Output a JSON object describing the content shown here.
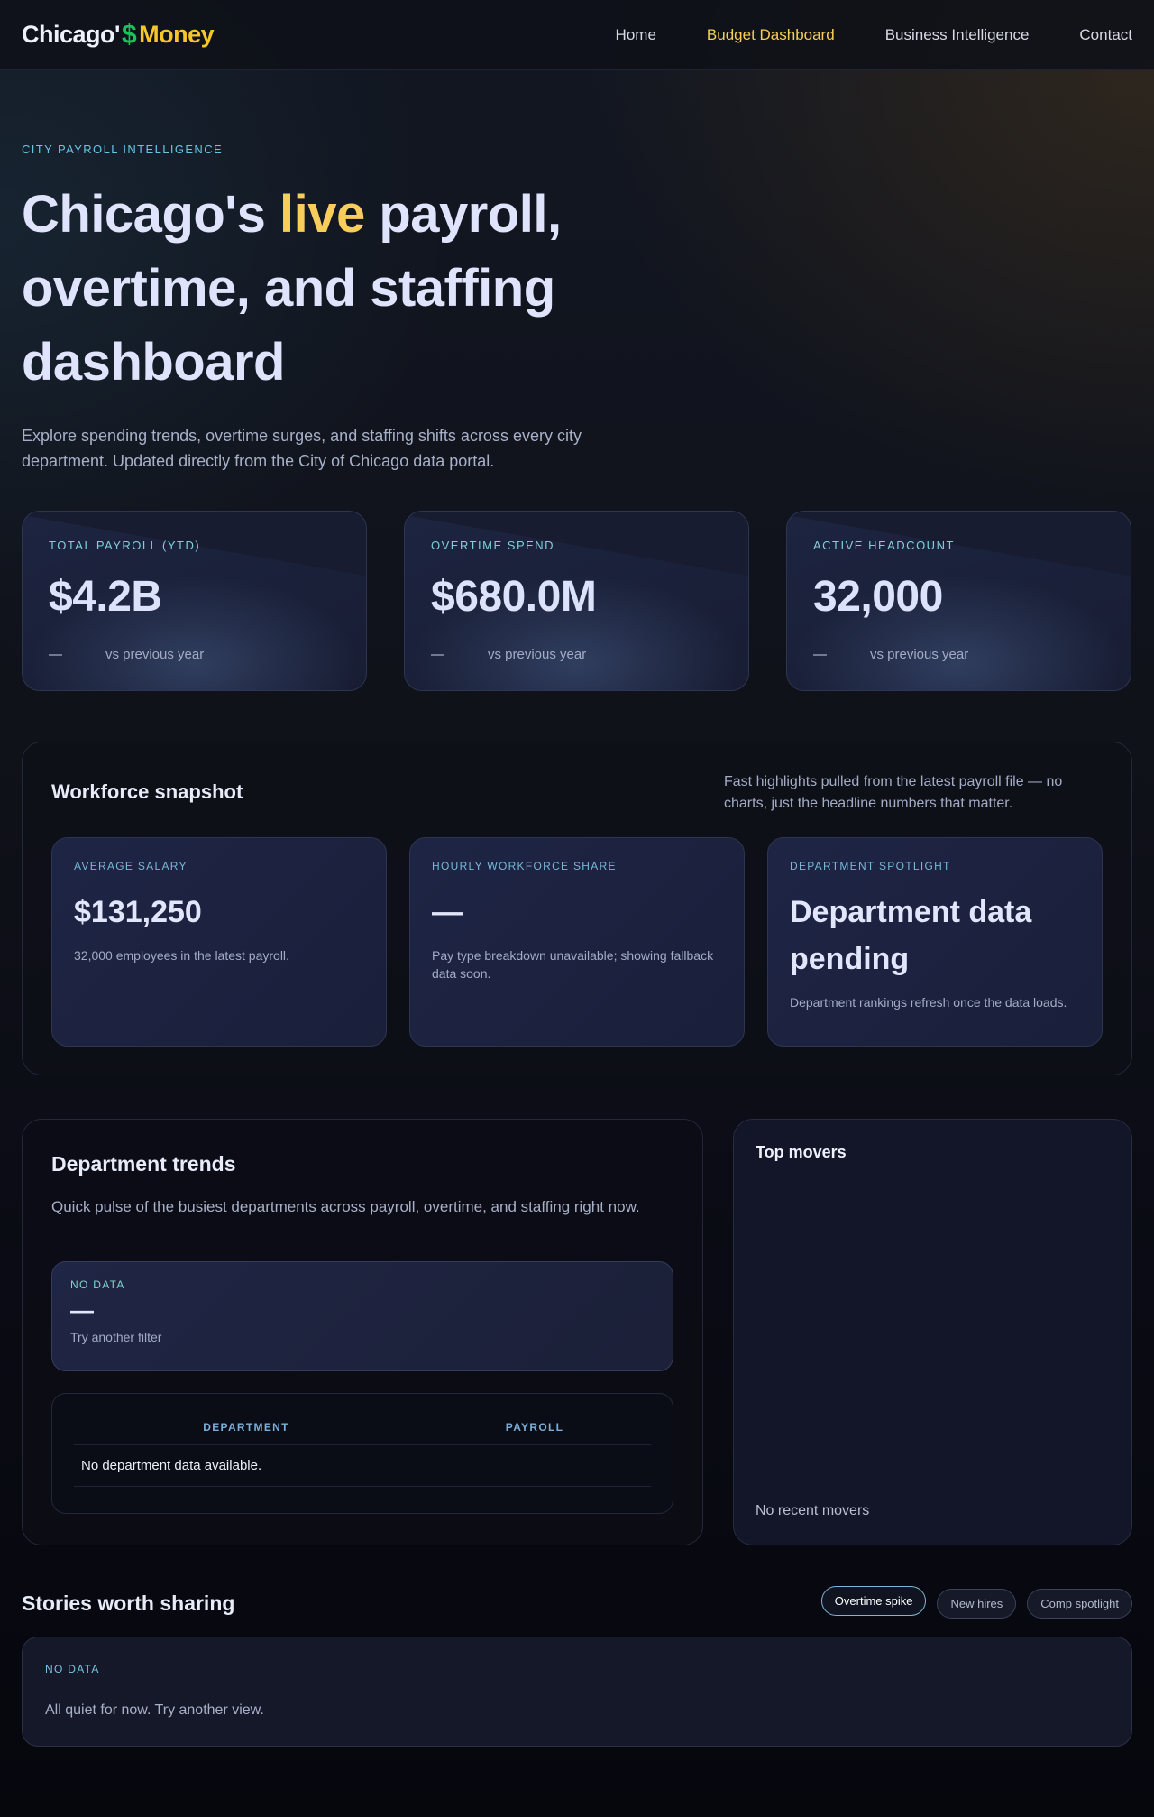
{
  "nav": {
    "logo_part1": "Chicago'",
    "logo_symbol": "$",
    "logo_part2": "Money",
    "links": [
      "Home",
      "Budget Dashboard",
      "Business Intelligence",
      "Contact"
    ],
    "active_link": "Budget Dashboard"
  },
  "hero": {
    "eyebrow": "CITY PAYROLL INTELLIGENCE",
    "title_pre": "Chicago's ",
    "title_highlight": "live",
    "title_post": " payroll, overtime, and staffing dashboard",
    "description": "Explore spending trends, overtime surges, and staffing shifts across every city department. Updated directly from the City of Chicago data portal."
  },
  "stats": [
    {
      "label": "TOTAL PAYROLL (YTD)",
      "value": "$4.2B",
      "delta": "—",
      "delta_note": "vs previous year"
    },
    {
      "label": "OVERTIME SPEND",
      "value": "$680.0M",
      "delta": "—",
      "delta_note": "vs previous year"
    },
    {
      "label": "ACTIVE HEADCOUNT",
      "value": "32,000",
      "delta": "—",
      "delta_note": "vs previous year"
    }
  ],
  "snapshot": {
    "title": "Workforce snapshot",
    "description": "Fast highlights pulled from the latest payroll file — no charts, just the headline numbers that matter.",
    "cards": [
      {
        "label": "AVERAGE SALARY",
        "value": "$131,250",
        "note": "32,000 employees in the latest payroll."
      },
      {
        "label": "HOURLY WORKFORCE SHARE",
        "value": "—",
        "note": "Pay type breakdown unavailable; showing fallback data soon."
      },
      {
        "label": "DEPARTMENT SPOTLIGHT",
        "value": "Department data pending",
        "note": "Department rankings refresh once the data loads."
      }
    ]
  },
  "trends": {
    "title": "Department trends",
    "subtitle": "Quick pulse of the busiest departments across payroll, overtime, and staffing right now.",
    "nodata_label": "NO DATA",
    "nodata_value": "—",
    "nodata_note": "Try another filter",
    "table_headers": [
      "DEPARTMENT",
      "PAYROLL"
    ],
    "table_empty": "No department data available."
  },
  "movers": {
    "title": "Top movers",
    "empty": "No recent movers"
  },
  "stories": {
    "title": "Stories worth sharing",
    "pills": [
      "Overtime spike",
      "New hires",
      "Comp spotlight"
    ],
    "active_pill": "Overtime spike",
    "label": "NO DATA",
    "note": "All quiet for now. Try another view."
  },
  "colors": {
    "accent_gold": "#f8cd5c",
    "accent_green": "#19c25a",
    "accent_teal": "#7fcfd8",
    "background": "#0a0b14"
  }
}
